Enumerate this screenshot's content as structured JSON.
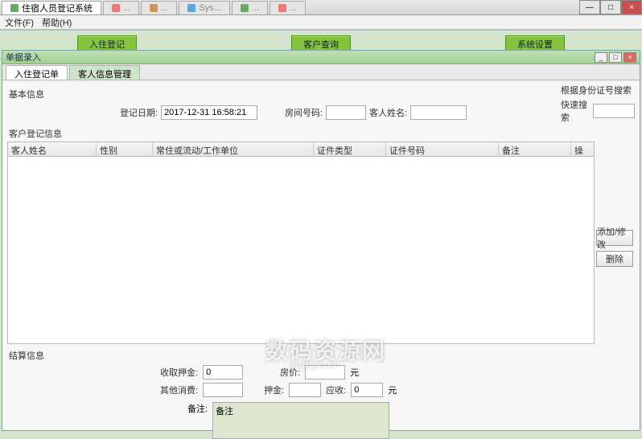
{
  "window": {
    "title": "住宿人员登记系统",
    "otherTabs": [
      "...",
      "...",
      "Sys...",
      "...",
      "..."
    ],
    "minimize": "—",
    "maximize": "□",
    "close": "×"
  },
  "menubar": {
    "file": "文件(F)",
    "help": "帮助(H)"
  },
  "mainbar": {
    "checkin": "入住登记",
    "query": "客户查询",
    "settings": "系统设置"
  },
  "subwindow": {
    "title": "单据录入",
    "min": "_",
    "max": "□",
    "close": "×",
    "tab1": "入住登记单",
    "tab2": "客人信息管理"
  },
  "basic": {
    "group": "基本信息",
    "dateLabel": "登记日期:",
    "dateValue": "2017-12-31 16:58:21",
    "roomLabel": "房间号码:",
    "roomValue": "",
    "guestLabel": "客人姓名:",
    "guestValue": ""
  },
  "search": {
    "line1": "根据身份证号搜索",
    "line2": "快速搜索",
    "value": ""
  },
  "guestGrid": {
    "group": "客户登记信息",
    "cols": {
      "name": "客人姓名",
      "sex": "性别",
      "addr": "常住或流动/工作单位",
      "idtype": "证件类型",
      "idno": "证件号码",
      "remark": "备注",
      "op": "操"
    }
  },
  "sideButtons": {
    "add": "添加/修改",
    "del": "删除"
  },
  "fee": {
    "group": "结算信息",
    "depositLabel": "收取押金:",
    "depositValue": "0",
    "roomFeeLabel": "房价:",
    "roomFeeValue": "",
    "otherFeeLabel": "其他消费:",
    "otherFeeValue": "",
    "depositRetLabel": "押金:",
    "depositRetValue": "",
    "receiveLabel": "应收:",
    "receiveValue": "0",
    "unit": "元",
    "remarkLabel": "备注:",
    "remarkValue": "备注"
  },
  "watermark": {
    "line1": "数码资源网",
    "line2": "smzy.com"
  }
}
